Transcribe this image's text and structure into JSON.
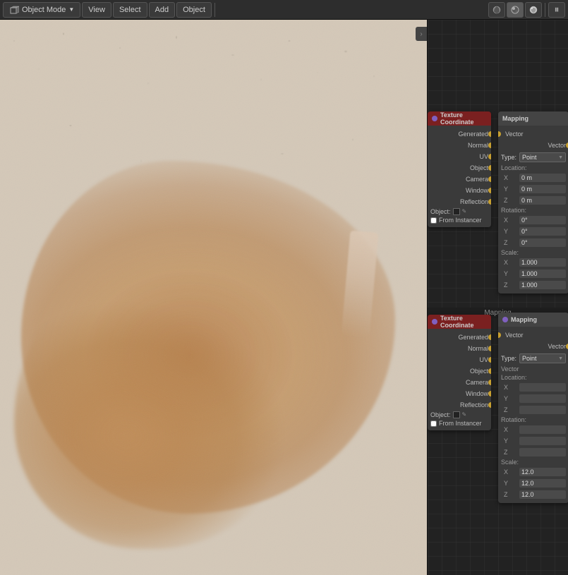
{
  "toolbar": {
    "mode_label": "Object Mode",
    "view_label": "View",
    "select_label": "Select",
    "add_label": "Add",
    "object_label": "Object"
  },
  "node_editor": {
    "section2_title": "Mapping",
    "tex_coord_1": {
      "header": "Texture Coordinate",
      "rows": [
        "Generated",
        "Normal",
        "UV",
        "Object",
        "Camera",
        "Window",
        "Reflection"
      ],
      "object_label": "Object:",
      "instancer_label": "From Instancer"
    },
    "mapping_1": {
      "header": "Mapping",
      "vector_label": "Vector",
      "type_label": "Type:",
      "type_value": "Point",
      "vector_field": "Vector",
      "location_label": "Location:",
      "loc_x": "0 m",
      "loc_y": "0 m",
      "loc_z": "0 m",
      "rotation_label": "Rotation:",
      "rot_x": "0°",
      "rot_y": "0°",
      "rot_z": "0°",
      "scale_label": "Scale:",
      "scale_x": "1.000",
      "scale_y": "1.000",
      "scale_z": "1.000"
    },
    "tex_coord_2": {
      "header": "Texture Coordinate",
      "rows": [
        "Generated",
        "Normal",
        "UV",
        "Object",
        "Camera",
        "Window",
        "Reflection"
      ],
      "object_label": "Object:",
      "instancer_label": "From Instancer"
    },
    "mapping_2": {
      "header": "Mapping",
      "vector_label": "Vector",
      "type_label": "Type:",
      "type_value": "Point",
      "vector_field": "Vector",
      "location_label": "Location:",
      "scale_label": "Scale:",
      "scale_x": "12.0",
      "scale_y": "12.0",
      "scale_z": "12.0"
    }
  }
}
